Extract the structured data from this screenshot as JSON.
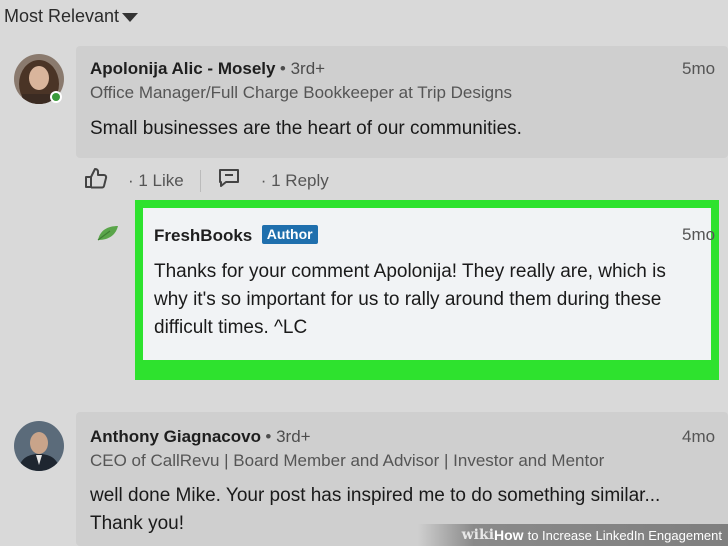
{
  "sort": {
    "label": "Most Relevant"
  },
  "comments": [
    {
      "name": "Apolonija Alic - Mosely",
      "degree": "• 3rd+",
      "headline": "Office Manager/Full Charge Bookkeeper at Trip Designs",
      "time": "5mo",
      "text": "Small businesses are the heart of our communities.",
      "likes": "· 1 Like",
      "replies": "· 1 Reply",
      "online": true
    },
    {
      "name": "Anthony Giagnacovo",
      "degree": "• 3rd+",
      "headline": "CEO of CallRevu | Board Member and Advisor | Investor and Mentor",
      "time": "4mo",
      "text_line1": "well done Mike.  Your post has inspired me to do something similar...",
      "text_line2": "Thank you!"
    }
  ],
  "reply": {
    "name": "FreshBooks",
    "badge": "Author",
    "time": "5mo",
    "line1": "Thanks for your comment Apolonija! They really are, which is",
    "line2": "why it's so important for us to rally around them during these",
    "line3": "difficult times. ^LC",
    "highlight_color": "#2ee22e"
  },
  "watermark": {
    "wiki": "wiki",
    "how": "How",
    "rest": "to Increase LinkedIn Engagement"
  }
}
